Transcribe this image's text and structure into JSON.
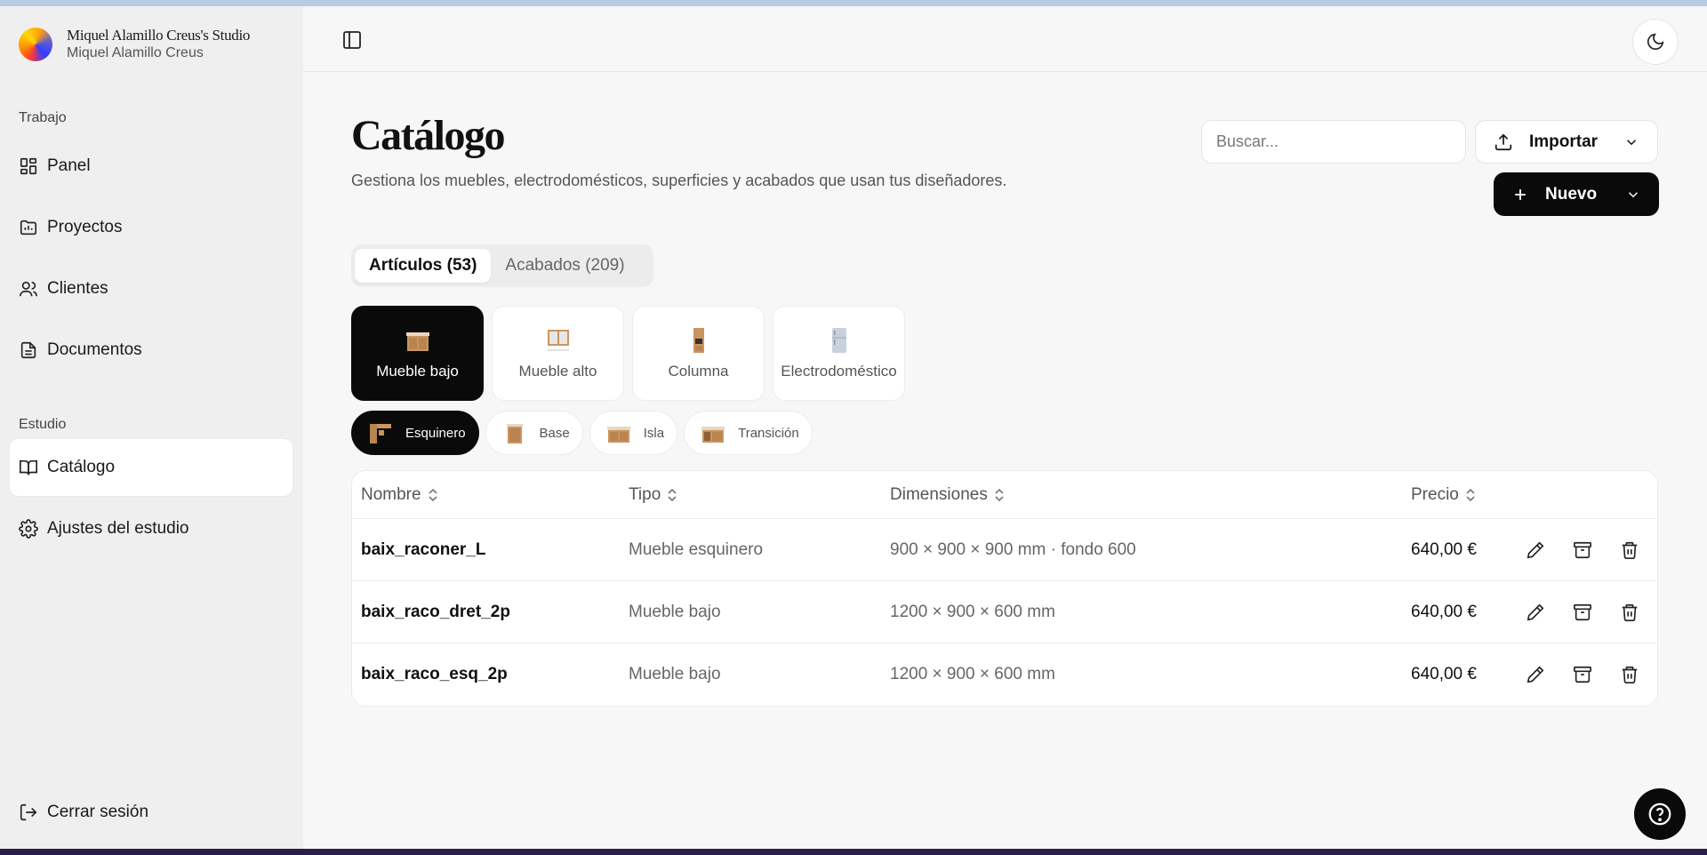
{
  "sidebar": {
    "studio_name": "Miquel Alamillo Creus's Studio",
    "studio_owner": "Miquel Alamillo Creus",
    "section_work": "Trabajo",
    "section_studio": "Estudio",
    "items": [
      {
        "label": "Panel",
        "icon": "dashboard-icon"
      },
      {
        "label": "Proyectos",
        "icon": "folder-icon"
      },
      {
        "label": "Clientes",
        "icon": "users-icon"
      },
      {
        "label": "Documentos",
        "icon": "document-icon"
      },
      {
        "label": "Catálogo",
        "icon": "book-icon",
        "active": true
      },
      {
        "label": "Ajustes del estudio",
        "icon": "gear-icon"
      }
    ],
    "logout": "Cerrar sesión"
  },
  "header": {
    "title": "Catálogo",
    "subtitle": "Gestiona los muebles, electrodomésticos, superficies y acabados que usan tus diseñadores.",
    "search_placeholder": "Buscar...",
    "import_label": "Importar",
    "new_label": "Nuevo"
  },
  "tabs": [
    {
      "label": "Artículos (53)",
      "active": true
    },
    {
      "label": "Acabados (209)",
      "active": false
    }
  ],
  "categories": [
    {
      "label": "Mueble bajo",
      "active": true
    },
    {
      "label": "Mueble alto",
      "active": false
    },
    {
      "label": "Columna",
      "active": false
    },
    {
      "label": "Electrodoméstico",
      "active": false
    }
  ],
  "subcategories": [
    {
      "label": "Esquinero",
      "active": true
    },
    {
      "label": "Base",
      "active": false
    },
    {
      "label": "Isla",
      "active": false
    },
    {
      "label": "Transición",
      "active": false
    }
  ],
  "table": {
    "columns": [
      "Nombre",
      "Tipo",
      "Dimensiones",
      "Precio"
    ],
    "rows": [
      {
        "name": "baix_raconer_L",
        "type": "Mueble esquinero",
        "dims": "900 × 900 × 900 mm · fondo 600",
        "price": "640,00 €"
      },
      {
        "name": "baix_raco_dret_2p",
        "type": "Mueble bajo",
        "dims": "1200 × 900 × 600 mm",
        "price": "640,00 €"
      },
      {
        "name": "baix_raco_esq_2p",
        "type": "Mueble bajo",
        "dims": "1200 × 900 × 600 mm",
        "price": "640,00 €"
      }
    ]
  },
  "colors": {
    "accent": "#0a0a0a",
    "wood": "#c9955e"
  }
}
